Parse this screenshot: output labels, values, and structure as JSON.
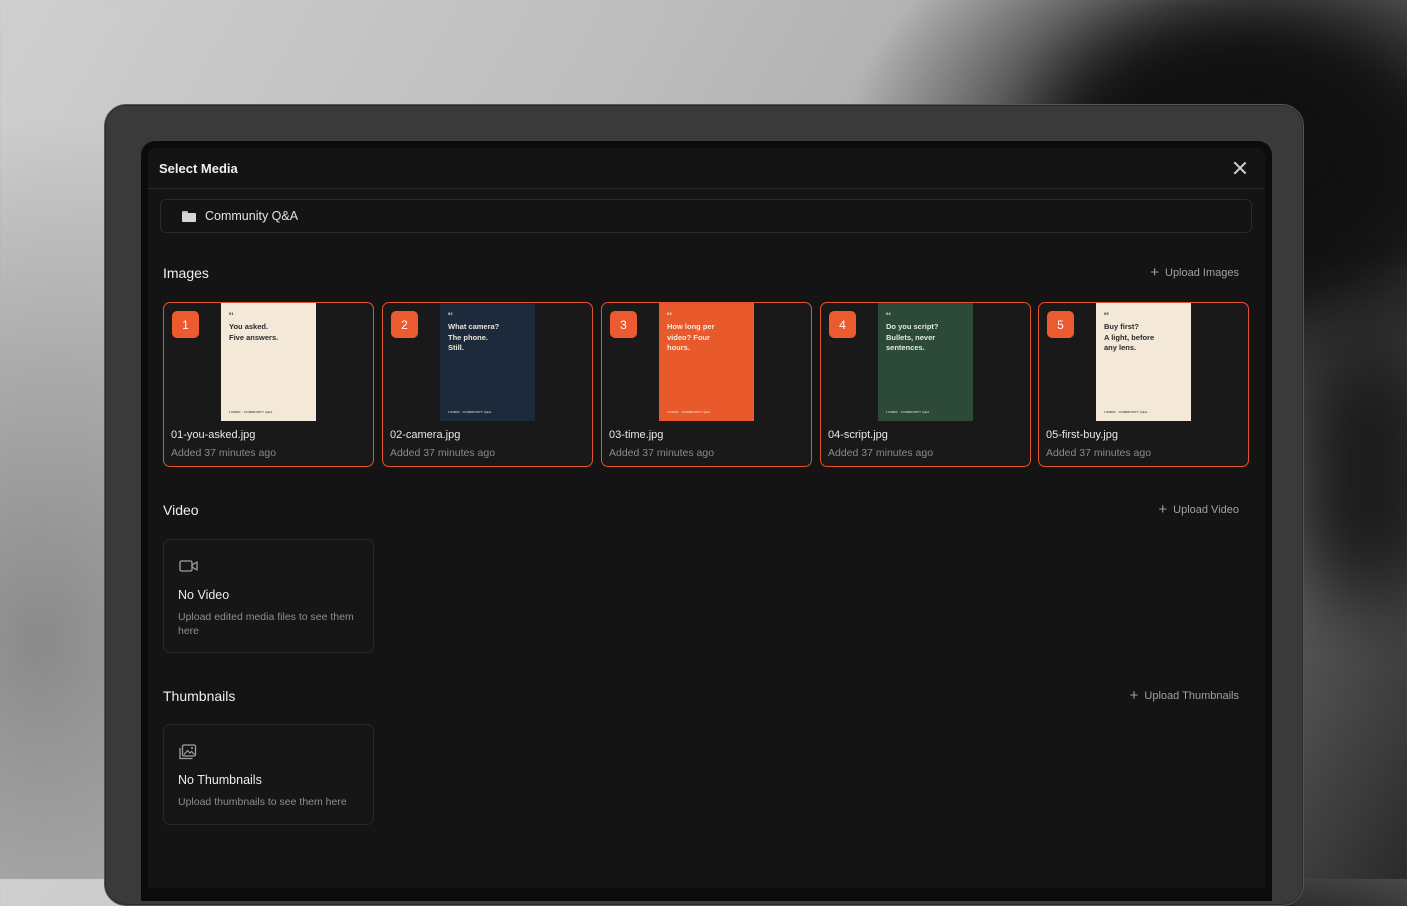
{
  "dialog": {
    "title": "Select Media",
    "project": "Community Q&A"
  },
  "images": {
    "title": "Images",
    "upload_label": "Upload Images",
    "accent": "#ee5a2f",
    "items": [
      {
        "index": "1",
        "poster_num": "01",
        "poster_text": [
          "You asked.",
          "Five answers."
        ],
        "poster_footer": "LUMEN · COMMUNITY Q&A",
        "poster_bg": "#f4e8d8",
        "poster_fg": "#2a2a2a",
        "file": "01-you-asked.jpg",
        "meta": "Added 37 minutes ago"
      },
      {
        "index": "2",
        "poster_num": "02",
        "poster_text": [
          "What camera?",
          "The phone.",
          "Still."
        ],
        "poster_footer": "LUMEN · COMMUNITY Q&A",
        "poster_bg": "#1d2a3b",
        "poster_fg": "#e9e4dc",
        "file": "02-camera.jpg",
        "meta": "Added 37 minutes ago"
      },
      {
        "index": "3",
        "poster_num": "03",
        "poster_text": [
          "How long per",
          "video? Four",
          "hours."
        ],
        "poster_footer": "LUMEN · COMMUNITY Q&A",
        "poster_bg": "#e85a2c",
        "poster_fg": "#fbe9df",
        "file": "03-time.jpg",
        "meta": "Added 37 minutes ago"
      },
      {
        "index": "4",
        "poster_num": "04",
        "poster_text": [
          "Do you script?",
          "Bullets, never",
          "sentences."
        ],
        "poster_footer": "LUMEN · COMMUNITY Q&A",
        "poster_bg": "#2c4a37",
        "poster_fg": "#e4ebe2",
        "file": "04-script.jpg",
        "meta": "Added 37 minutes ago"
      },
      {
        "index": "5",
        "poster_num": "05",
        "poster_text": [
          "Buy first?",
          "A light, before",
          "any lens."
        ],
        "poster_footer": "LUMEN · COMMUNITY Q&A",
        "poster_bg": "#f4e8d8",
        "poster_fg": "#2a2a2a",
        "file": "05-first-buy.jpg",
        "meta": "Added 37 minutes ago"
      }
    ]
  },
  "video": {
    "title": "Video",
    "upload_label": "Upload Video",
    "empty_title": "No Video",
    "empty_sub": "Upload edited media files to see them here",
    "icon": "video-camera-icon"
  },
  "thumbnails": {
    "title": "Thumbnails",
    "upload_label": "Upload Thumbnails",
    "empty_title": "No Thumbnails",
    "empty_sub": "Upload thumbnails to see them here",
    "icon": "image-stack-icon"
  }
}
